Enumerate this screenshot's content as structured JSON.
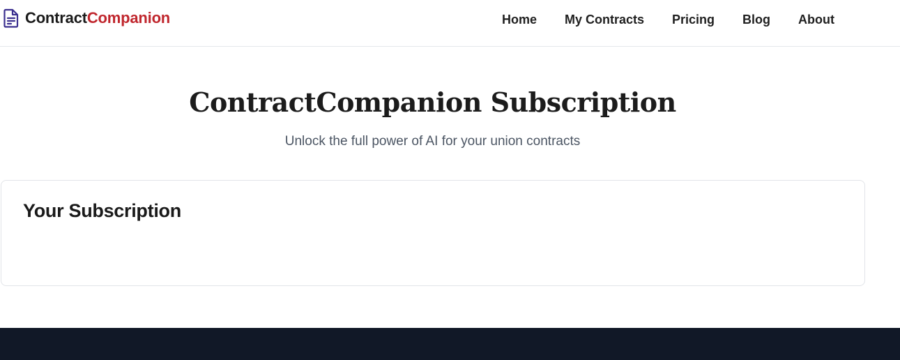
{
  "brand": {
    "name_part1": "Contract",
    "name_part2": "Companion",
    "icon": "document-icon",
    "color_primary": "#1a1a1a",
    "color_accent": "#c0262d",
    "icon_color": "#3b2f8f"
  },
  "nav": {
    "items": [
      {
        "label": "Home"
      },
      {
        "label": "My Contracts"
      },
      {
        "label": "Pricing"
      },
      {
        "label": "Blog"
      },
      {
        "label": "About"
      }
    ]
  },
  "hero": {
    "title": "ContractCompanion Subscription",
    "subtitle": "Unlock the full power of AI for your union contracts"
  },
  "subscription_card": {
    "title": "Your Subscription"
  },
  "footer": {
    "background": "#111827"
  }
}
